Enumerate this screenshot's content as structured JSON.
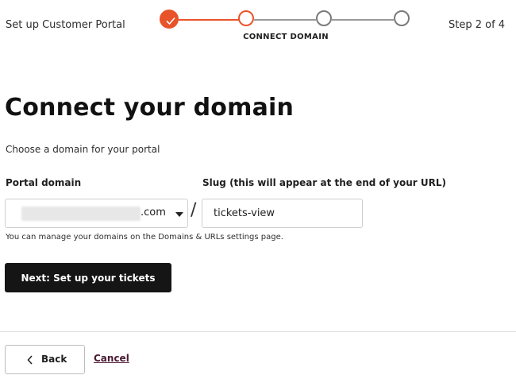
{
  "header": {
    "title": "Set up Customer Portal",
    "step_indicator": "Step 2 of 4",
    "stepper": {
      "total_steps": 4,
      "completed_steps": 1,
      "current_step_label": "CONNECT DOMAIN"
    }
  },
  "main": {
    "title": "Connect your domain",
    "subtitle": "Choose a domain for your portal",
    "portal_domain": {
      "label": "Portal domain",
      "suffix": ".com"
    },
    "slug": {
      "label": "Slug (this will appear at the end of your URL)",
      "value": "tickets-view"
    },
    "separator": "/",
    "help_text": "You can manage your domains on the Domains & URLs settings page.",
    "next_button": "Next: Set up your tickets"
  },
  "footer": {
    "back_button": "Back",
    "cancel_link": "Cancel"
  },
  "colors": {
    "accent": "#e9532a",
    "primary_button": "#151515",
    "cancel_link": "#4a1a33"
  }
}
